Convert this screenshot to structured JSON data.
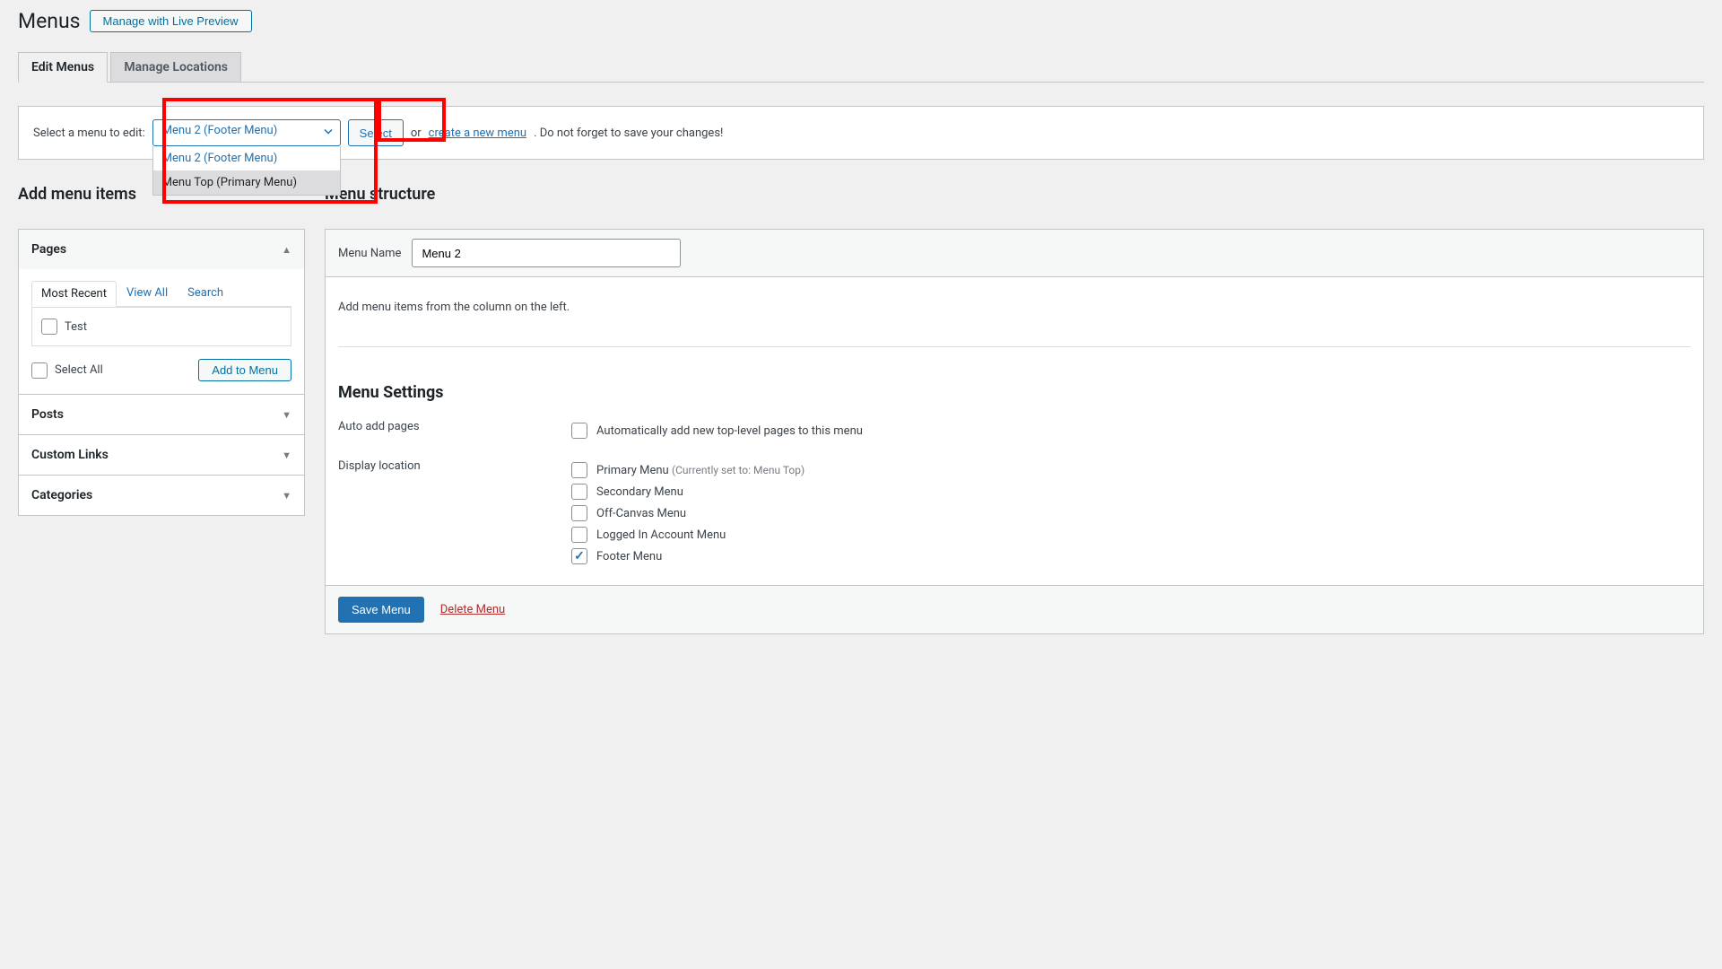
{
  "header": {
    "title": "Menus",
    "live_preview_label": "Manage with Live Preview"
  },
  "tabs": {
    "edit": "Edit Menus",
    "locations": "Manage Locations"
  },
  "selector_bar": {
    "prefix": "Select a menu to edit:",
    "selected": "Menu 2 (Footer Menu)",
    "options": [
      "Menu 2 (Footer Menu)",
      "Menu Top (Primary Menu)"
    ],
    "select_btn": "Select",
    "or_text": "or ",
    "create_link": "create a new menu",
    "suffix": ". Do not forget to save your changes!"
  },
  "left": {
    "title": "Add menu items",
    "pages": {
      "label": "Pages",
      "tabs": {
        "recent": "Most Recent",
        "view_all": "View All",
        "search": "Search"
      },
      "items": [
        "Test"
      ],
      "select_all": "Select All",
      "add_btn": "Add to Menu"
    },
    "posts": "Posts",
    "custom_links": "Custom Links",
    "categories": "Categories"
  },
  "right": {
    "title": "Menu structure",
    "menu_name_label": "Menu Name",
    "menu_name_value": "Menu 2",
    "instruction": "Add menu items from the column on the left.",
    "settings_title": "Menu Settings",
    "auto_add_label": "Auto add pages",
    "auto_add_option": "Automatically add new top-level pages to this menu",
    "display_loc_label": "Display location",
    "locations": [
      {
        "label": "Primary Menu",
        "note": "(Currently set to: Menu Top)",
        "checked": false
      },
      {
        "label": "Secondary Menu",
        "note": "",
        "checked": false
      },
      {
        "label": "Off-Canvas Menu",
        "note": "",
        "checked": false
      },
      {
        "label": "Logged In Account Menu",
        "note": "",
        "checked": false
      },
      {
        "label": "Footer Menu",
        "note": "",
        "checked": true
      }
    ],
    "save_btn": "Save Menu",
    "delete_link": "Delete Menu"
  }
}
